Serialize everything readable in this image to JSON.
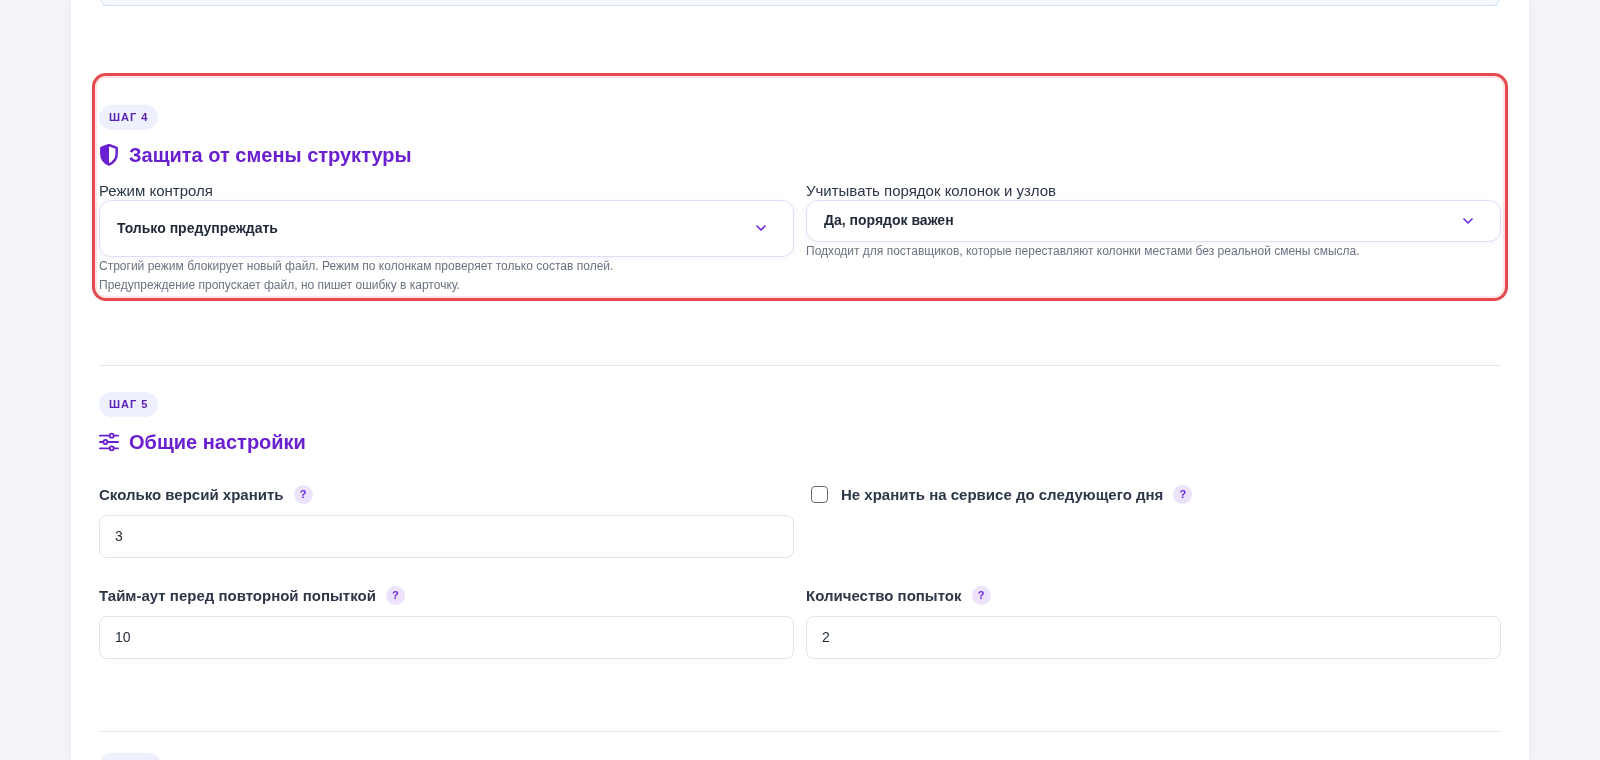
{
  "steps": [
    {
      "badge": "ШАГ 4",
      "title": "Защита от смены структуры",
      "highlighted": true,
      "fields": [
        {
          "kind": "select",
          "label": "Режим контроля",
          "value": "Только предупреждать",
          "help": [
            "Строгий режим блокирует новый файл. Режим по колонкам проверяет только состав полей.",
            "Предупреждение пропускает файл, но пишет ошибку в карточку."
          ]
        },
        {
          "kind": "select",
          "label": "Учитывать порядок колонок и узлов",
          "value": "Да, порядок важен",
          "help": [
            "Подходит для поставщиков, которые переставляют колонки местами без реальной смены смысла."
          ]
        }
      ]
    },
    {
      "badge": "ШАГ 5",
      "title": "Общие настройки",
      "highlighted": false,
      "fields": [
        {
          "kind": "number",
          "label": "Сколько версий хранить",
          "help_mark": "?",
          "value": "3"
        },
        {
          "kind": "checkbox",
          "label": "Не хранить на сервисе до следующего дня",
          "help_mark": "?",
          "checked": false
        },
        {
          "kind": "number",
          "label": "Тайм-аут перед повторной попыткой",
          "help_mark": "?",
          "value": "10"
        },
        {
          "kind": "number",
          "label": "Количество попыток",
          "help_mark": "?",
          "value": "2"
        }
      ]
    }
  ]
}
